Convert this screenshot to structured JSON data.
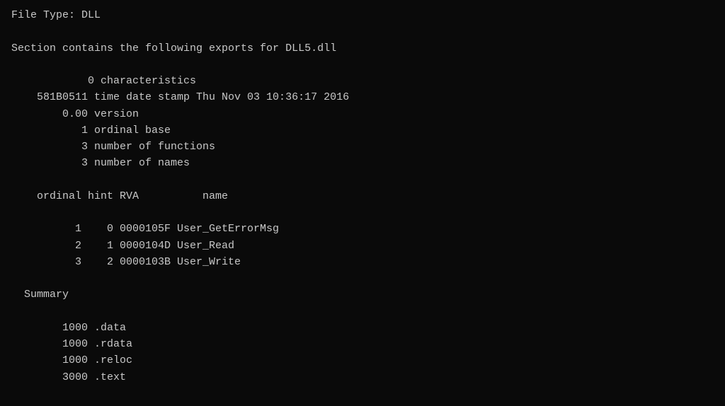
{
  "terminal": {
    "lines": [
      "File Type: DLL",
      "",
      "Section contains the following exports for DLL5.dll",
      "",
      "            0 characteristics",
      "    581B0511 time date stamp Thu Nov 03 10:36:17 2016",
      "        0.00 version",
      "           1 ordinal base",
      "           3 number of functions",
      "           3 number of names",
      "",
      "    ordinal hint RVA          name",
      "",
      "          1    0 0000105F User_GetErrorMsg",
      "          2    1 0000104D User_Read",
      "          3    2 0000103B User_Write",
      "",
      "  Summary",
      "",
      "        1000 .data",
      "        1000 .rdata",
      "        1000 .reloc",
      "        3000 .text"
    ]
  }
}
